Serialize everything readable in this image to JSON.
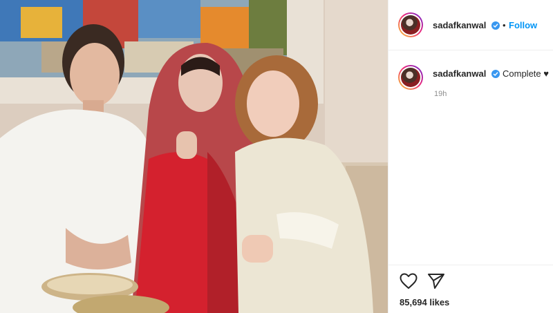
{
  "post": {
    "username": "sadafkanwal",
    "separator": "•",
    "follow_label": "Follow",
    "caption_username": "sadafkanwal",
    "caption_text": "Complete ♥",
    "time_ago": "19h",
    "likes": "85,694 likes"
  },
  "icons": {
    "like": "heart-outline-icon",
    "share": "paper-plane-icon",
    "verified": "verified-badge-icon"
  },
  "colors": {
    "link_blue": "#0095f6",
    "verified_blue": "#3897f0",
    "muted": "#8e8e8e",
    "text": "#262626"
  }
}
